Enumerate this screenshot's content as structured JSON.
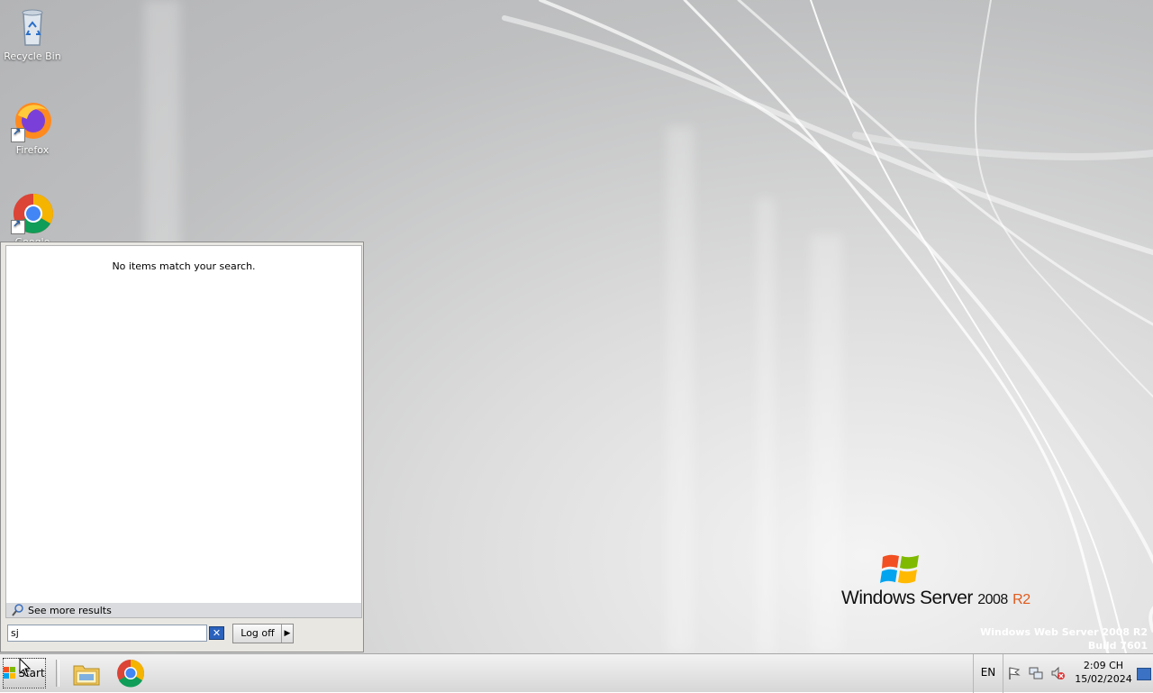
{
  "desktop": {
    "icons": [
      {
        "label": "Recycle Bin",
        "icon": "recycle-bin-icon"
      },
      {
        "label": "Firefox",
        "icon": "firefox-icon"
      },
      {
        "label": "Google Chrome",
        "icon": "chrome-icon"
      }
    ],
    "branding": {
      "product": "Windows Server",
      "version": "2008",
      "release": "R2",
      "edition": "Windows Web Server 2008 R2",
      "build": "Build 7601"
    }
  },
  "start_menu": {
    "no_results_text": "No items match your search.",
    "see_more_label": "See more results",
    "search_value": "sj",
    "logoff_label": "Log off"
  },
  "taskbar": {
    "start_label": "Start",
    "pinned": [
      "windows-explorer-icon",
      "chrome-icon"
    ],
    "language": "EN",
    "tray_icons": [
      "action-center-flag-icon",
      "network-icon",
      "volume-muted-icon"
    ],
    "time": "2:09 CH",
    "date": "15/02/2024"
  },
  "colors": {
    "accent": "#2a62bd",
    "brand_r2": "#e05a1c"
  }
}
